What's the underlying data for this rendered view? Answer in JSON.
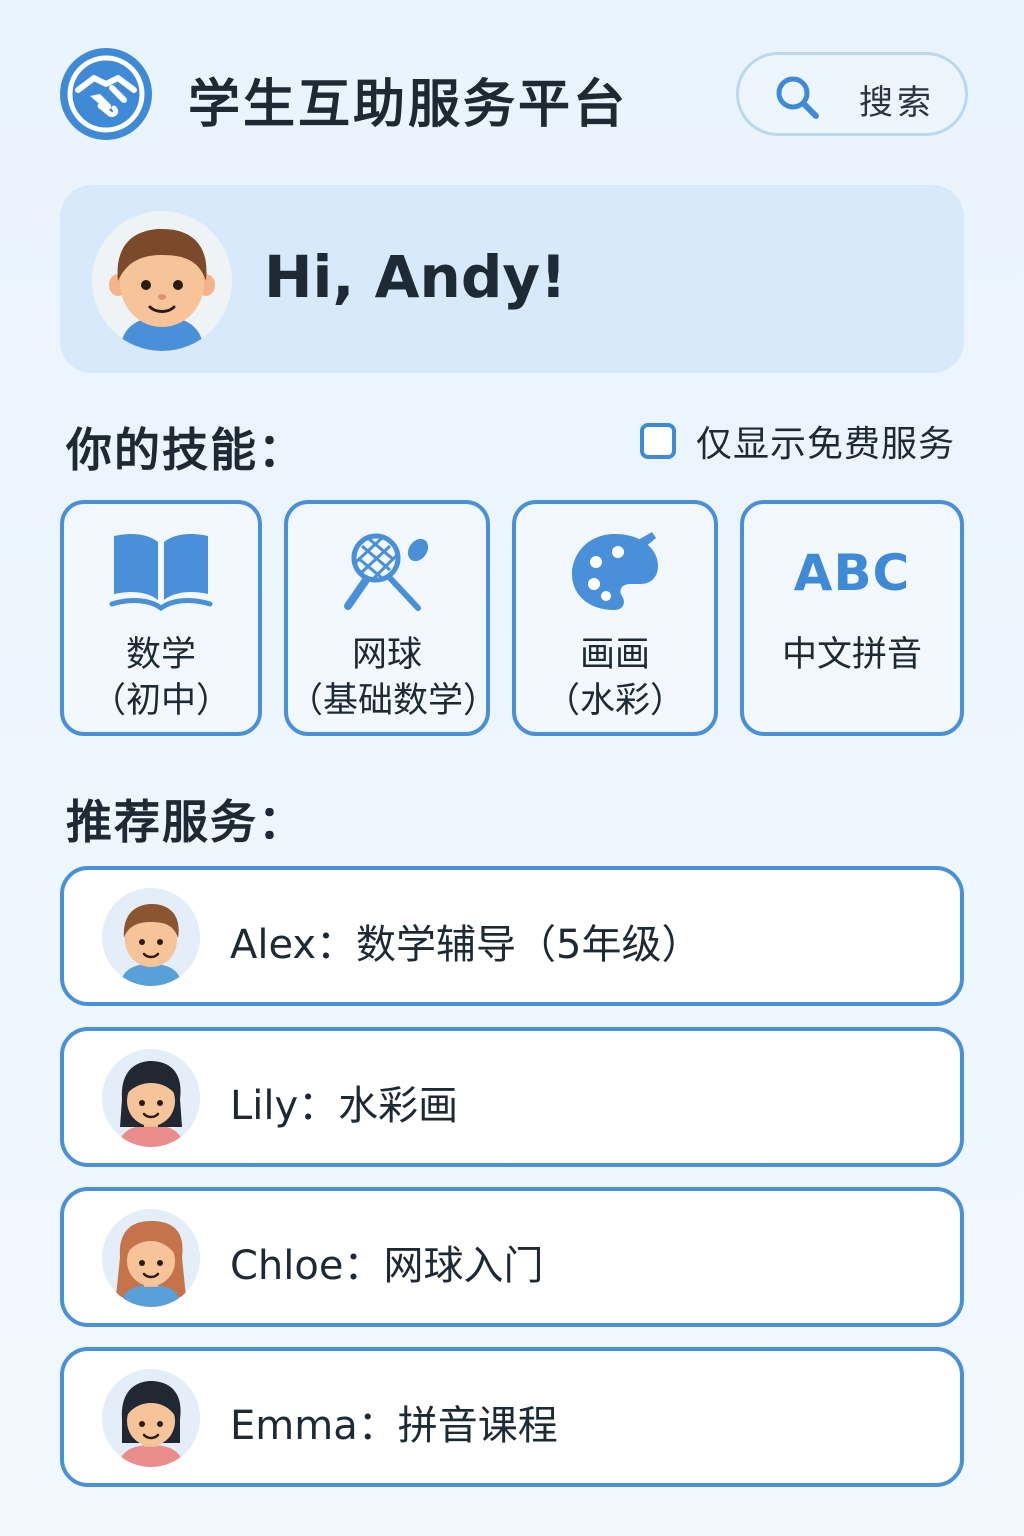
{
  "header": {
    "app_title": "学生互助服务平台",
    "search_label": "搜索"
  },
  "greeting": {
    "text": "Hi, Andy!"
  },
  "skills": {
    "title": "你的技能：",
    "free_only_label": "仅显示免费服务",
    "free_only_checked": false,
    "items": [
      {
        "icon": "book-icon",
        "line1": "数学",
        "line2": "（初中）"
      },
      {
        "icon": "racket-icon",
        "line1": "网球",
        "line2": "（基础数学）"
      },
      {
        "icon": "palette-icon",
        "line1": "画画",
        "line2": "（水彩）"
      },
      {
        "icon_text": "ABC",
        "line1": "中文拼音",
        "line2": ""
      }
    ]
  },
  "recommended": {
    "title": "推荐服务：",
    "items": [
      {
        "name": "Alex",
        "service": "数学辅导（5年级）",
        "text": "Alex：数学辅导（5年级）"
      },
      {
        "name": "Lily",
        "service": "水彩画",
        "text": "Lily：水彩画"
      },
      {
        "name": "Chloe",
        "service": "网球入门",
        "text": "Chloe：网球入门"
      },
      {
        "name": "Emma",
        "service": "拼音课程",
        "text": "Emma：拼音课程"
      }
    ]
  },
  "colors": {
    "accent": "#3f8ad6",
    "card_border": "#4a90d9",
    "greeting_bg": "#d7e9fa"
  }
}
